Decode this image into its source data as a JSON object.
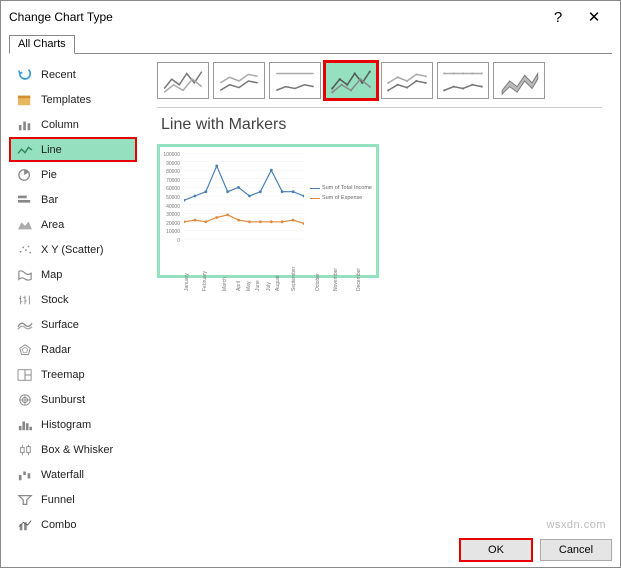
{
  "title": "Change Chart Type",
  "tabs": {
    "all": "All Charts"
  },
  "sidebar": {
    "items": [
      {
        "label": "Recent"
      },
      {
        "label": "Templates"
      },
      {
        "label": "Column"
      },
      {
        "label": "Line"
      },
      {
        "label": "Pie"
      },
      {
        "label": "Bar"
      },
      {
        "label": "Area"
      },
      {
        "label": "X Y (Scatter)"
      },
      {
        "label": "Map"
      },
      {
        "label": "Stock"
      },
      {
        "label": "Surface"
      },
      {
        "label": "Radar"
      },
      {
        "label": "Treemap"
      },
      {
        "label": "Sunburst"
      },
      {
        "label": "Histogram"
      },
      {
        "label": "Box & Whisker"
      },
      {
        "label": "Waterfall"
      },
      {
        "label": "Funnel"
      },
      {
        "label": "Combo"
      }
    ]
  },
  "subtitle": "Line with Markers",
  "buttons": {
    "ok": "OK",
    "cancel": "Cancel"
  },
  "watermark": "wsxdn.com",
  "chart_data": {
    "type": "line",
    "categories": [
      "January",
      "February",
      "March",
      "April",
      "May",
      "June",
      "July",
      "August",
      "September",
      "October",
      "November",
      "December"
    ],
    "series": [
      {
        "name": "Sum of Total Income",
        "color": "#4a7fb5",
        "values": [
          45000,
          50000,
          55000,
          85000,
          55000,
          60000,
          50000,
          55000,
          80000,
          55000,
          55000,
          50000
        ]
      },
      {
        "name": "Sum of Expense",
        "color": "#e08a3a",
        "values": [
          20000,
          22000,
          20000,
          25000,
          28000,
          22000,
          20000,
          20000,
          20000,
          20000,
          22000,
          18000
        ]
      }
    ],
    "yticks": [
      0,
      10000,
      20000,
      30000,
      40000,
      50000,
      60000,
      70000,
      80000,
      90000,
      100000
    ],
    "ylim": [
      0,
      100000
    ]
  }
}
